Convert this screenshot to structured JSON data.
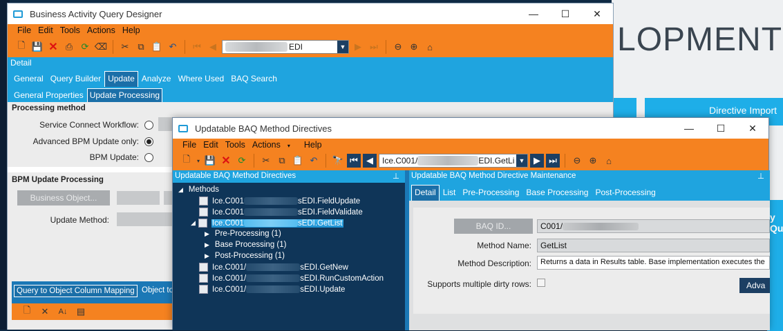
{
  "background": {
    "brand_text": "LOPMENT",
    "tile_label": "Directive Import",
    "side_tile_label": "y Qu"
  },
  "baq_window": {
    "title": "Business Activity Query Designer",
    "menu": [
      "File",
      "Edit",
      "Tools",
      "Actions",
      "Help"
    ],
    "query_combo_value": "EDI",
    "detail_label": "Detail",
    "tabs": [
      "General",
      "Query Builder",
      "Update",
      "Analyze",
      "Where Used",
      "BAQ Search"
    ],
    "active_tab": "Update",
    "subtabs": [
      "General Properties",
      "Update Processing"
    ],
    "active_subtab": "Update Processing",
    "processing_method_title": "Processing method",
    "options": [
      {
        "label": "Service Connect Workflow:",
        "selected": false
      },
      {
        "label": "Advanced BPM Update only:",
        "selected": true
      },
      {
        "label": "BPM Update:",
        "selected": false
      }
    ],
    "bpm_section_title": "BPM Update Processing",
    "business_object_button": "Business Object...",
    "update_method_label": "Update Method:",
    "bottom_tabs": [
      "Query to Object Column Mapping",
      "Object to"
    ]
  },
  "directives_window": {
    "title": "Updatable BAQ Method Directives",
    "menu": [
      "File",
      "Edit",
      "Tools",
      "Actions",
      "Help"
    ],
    "actions_has_dropdown": true,
    "combo_value_prefix": "Ice.C001/",
    "combo_value_suffix": "EDI.GetLi",
    "left_panel_title": "Updatable BAQ Method Directives",
    "right_panel_title": "Updatable BAQ Method Directive Maintenance",
    "tree_root": "Methods",
    "methods": [
      {
        "prefix": "Ice.C001",
        "suffix": "sEDI.FieldUpdate",
        "expanded": false,
        "selected": false
      },
      {
        "prefix": "Ice.C001",
        "suffix": "sEDI.FieldValidate",
        "expanded": false,
        "selected": false
      },
      {
        "prefix": "Ice.C001",
        "suffix": "sEDI.GetList",
        "expanded": true,
        "selected": true
      },
      {
        "prefix": "Ice.C001/",
        "suffix": "sEDI.GetNew",
        "expanded": false,
        "selected": false
      },
      {
        "prefix": "Ice.C001/",
        "suffix": "sEDI.RunCustomAction",
        "expanded": false,
        "selected": false
      },
      {
        "prefix": "Ice.C001/",
        "suffix": "sEDI.Update",
        "expanded": false,
        "selected": false
      }
    ],
    "subnodes": [
      "Pre-Processing (1)",
      "Base Processing (1)",
      "Post-Processing (1)"
    ],
    "tabs": [
      "Detail",
      "List",
      "Pre-Processing",
      "Base Processing",
      "Post-Processing"
    ],
    "active_tab": "Detail",
    "baq_id_button": "BAQ ID...",
    "baq_id_value": "C001/",
    "method_name_label": "Method Name:",
    "method_name_value": "GetList",
    "method_description_label": "Method Description:",
    "method_description_value": "Returns a data in Results table. Base implementation executes the",
    "multiple_dirty_label": "Supports multiple dirty rows:",
    "advanced_button": "Adva"
  },
  "colors": {
    "orange": "#f58220",
    "blue": "#1fa4df",
    "tree_bg": "#0f3558"
  }
}
